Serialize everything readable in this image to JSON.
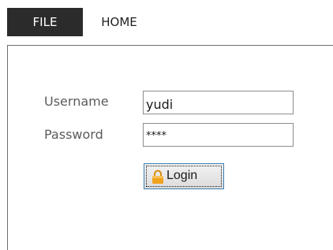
{
  "ribbon": {
    "tabs": [
      {
        "label": "FILE",
        "active": true
      },
      {
        "label": "HOME",
        "active": false
      }
    ]
  },
  "login_form": {
    "username_label": "Username",
    "username_value": "yudi",
    "password_label": "Password",
    "password_value": "****",
    "login_button_label": "Login",
    "login_button_icon": "lock-icon"
  },
  "colors": {
    "active_tab_bg": "#2b2b2b",
    "active_tab_text": "#ffffff",
    "label_text": "#5b5b5b",
    "button_border": "#3c7fb1",
    "lock_icon": "#f0a31f"
  }
}
